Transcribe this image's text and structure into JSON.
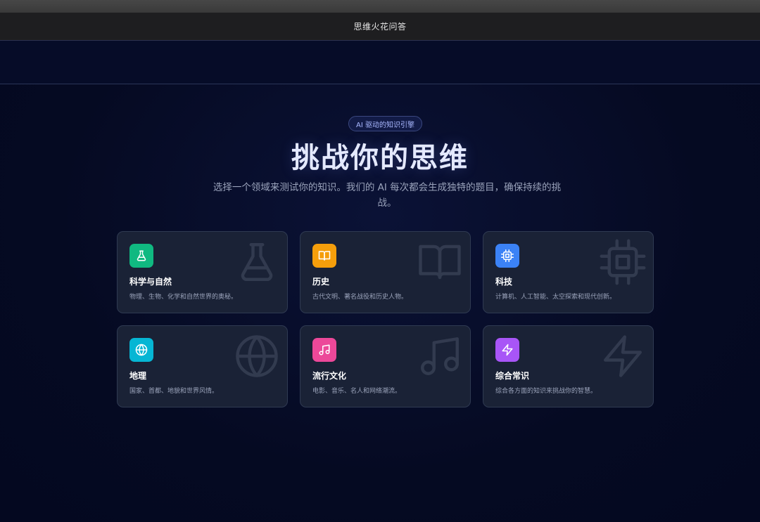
{
  "window": {
    "title": "思维火花问答"
  },
  "hero": {
    "badge": "AI 驱动的知识引擎",
    "title": "挑战你的思维",
    "subtitle": "选择一个领域来测试你的知识。我们的 AI 每次都会生成独特的题目，确保持续的挑战。"
  },
  "categories": [
    {
      "title": "科学与自然",
      "desc": "物理、生物、化学和自然世界的奥秘。",
      "icon": "flask-icon",
      "color": "#10b981"
    },
    {
      "title": "历史",
      "desc": "古代文明、著名战役和历史人物。",
      "icon": "book-icon",
      "color": "#f59e0b"
    },
    {
      "title": "科技",
      "desc": "计算机、人工智能、太空探索和现代创新。",
      "icon": "chip-icon",
      "color": "#3b82f6"
    },
    {
      "title": "地理",
      "desc": "国家、首都、地貌和世界风情。",
      "icon": "globe-icon",
      "color": "#06b6d4"
    },
    {
      "title": "流行文化",
      "desc": "电影、音乐、名人和网络潮流。",
      "icon": "music-icon",
      "color": "#ec4899"
    },
    {
      "title": "综合常识",
      "desc": "综合各方面的知识来挑战你的智慧。",
      "icon": "lightning-icon",
      "color": "#a855f7"
    }
  ]
}
